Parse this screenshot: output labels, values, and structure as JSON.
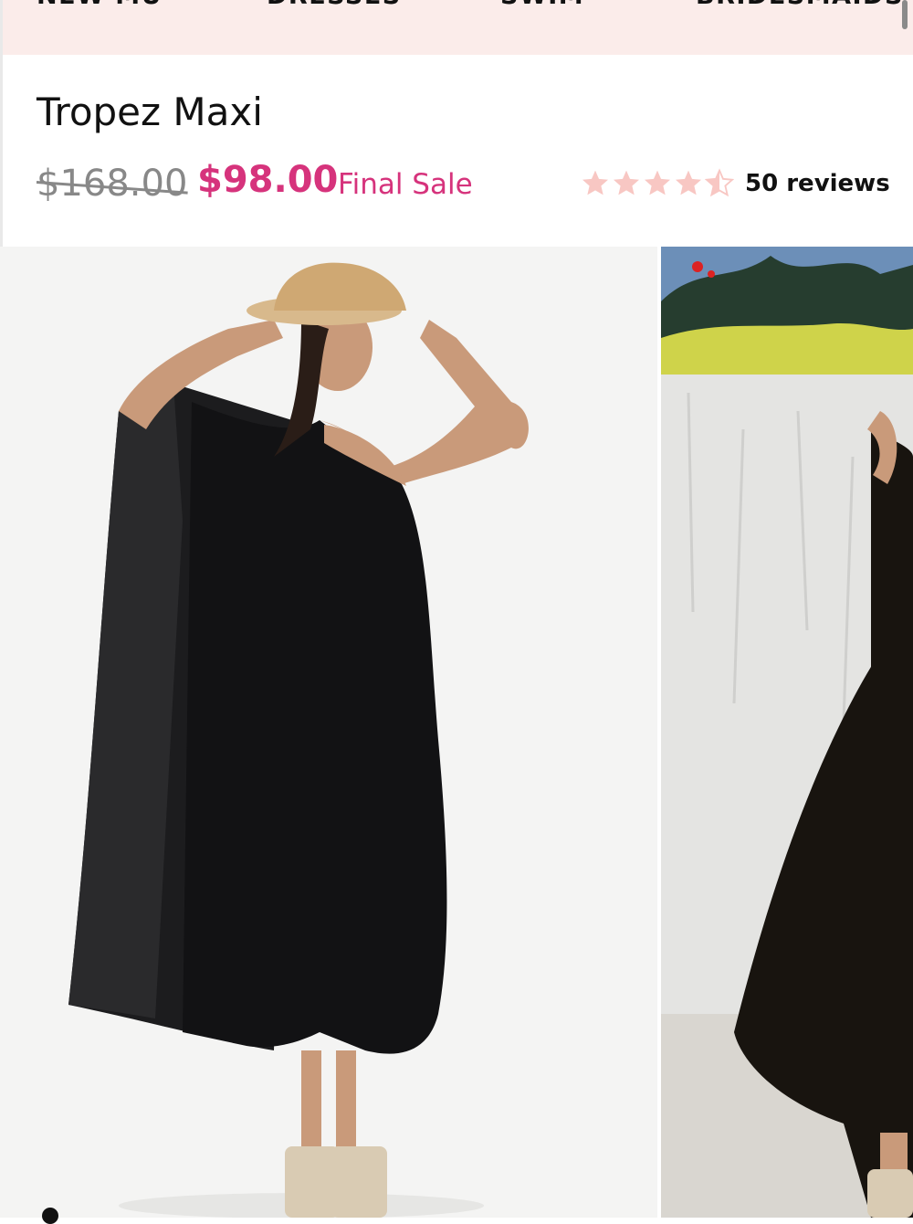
{
  "nav": {
    "items": [
      "NEW MU",
      "DRESSES",
      "SWIM",
      "BRIDESMAIDS"
    ]
  },
  "product": {
    "title": "Tropez Maxi",
    "price_original": "$168.00",
    "price_sale": "$98.00",
    "sale_note": "Final Sale",
    "rating": 4.5,
    "rating_max": 5,
    "reviews_label": "50 reviews"
  },
  "colors": {
    "sale_pink": "#d6337c",
    "star_pink": "#f8c7c3",
    "nav_bg": "#fbecea"
  },
  "gallery": {
    "images": [
      "model-black-one-shoulder-maxi-studio",
      "model-black-maxi-outdoor-wall"
    ],
    "current_index": 0
  }
}
